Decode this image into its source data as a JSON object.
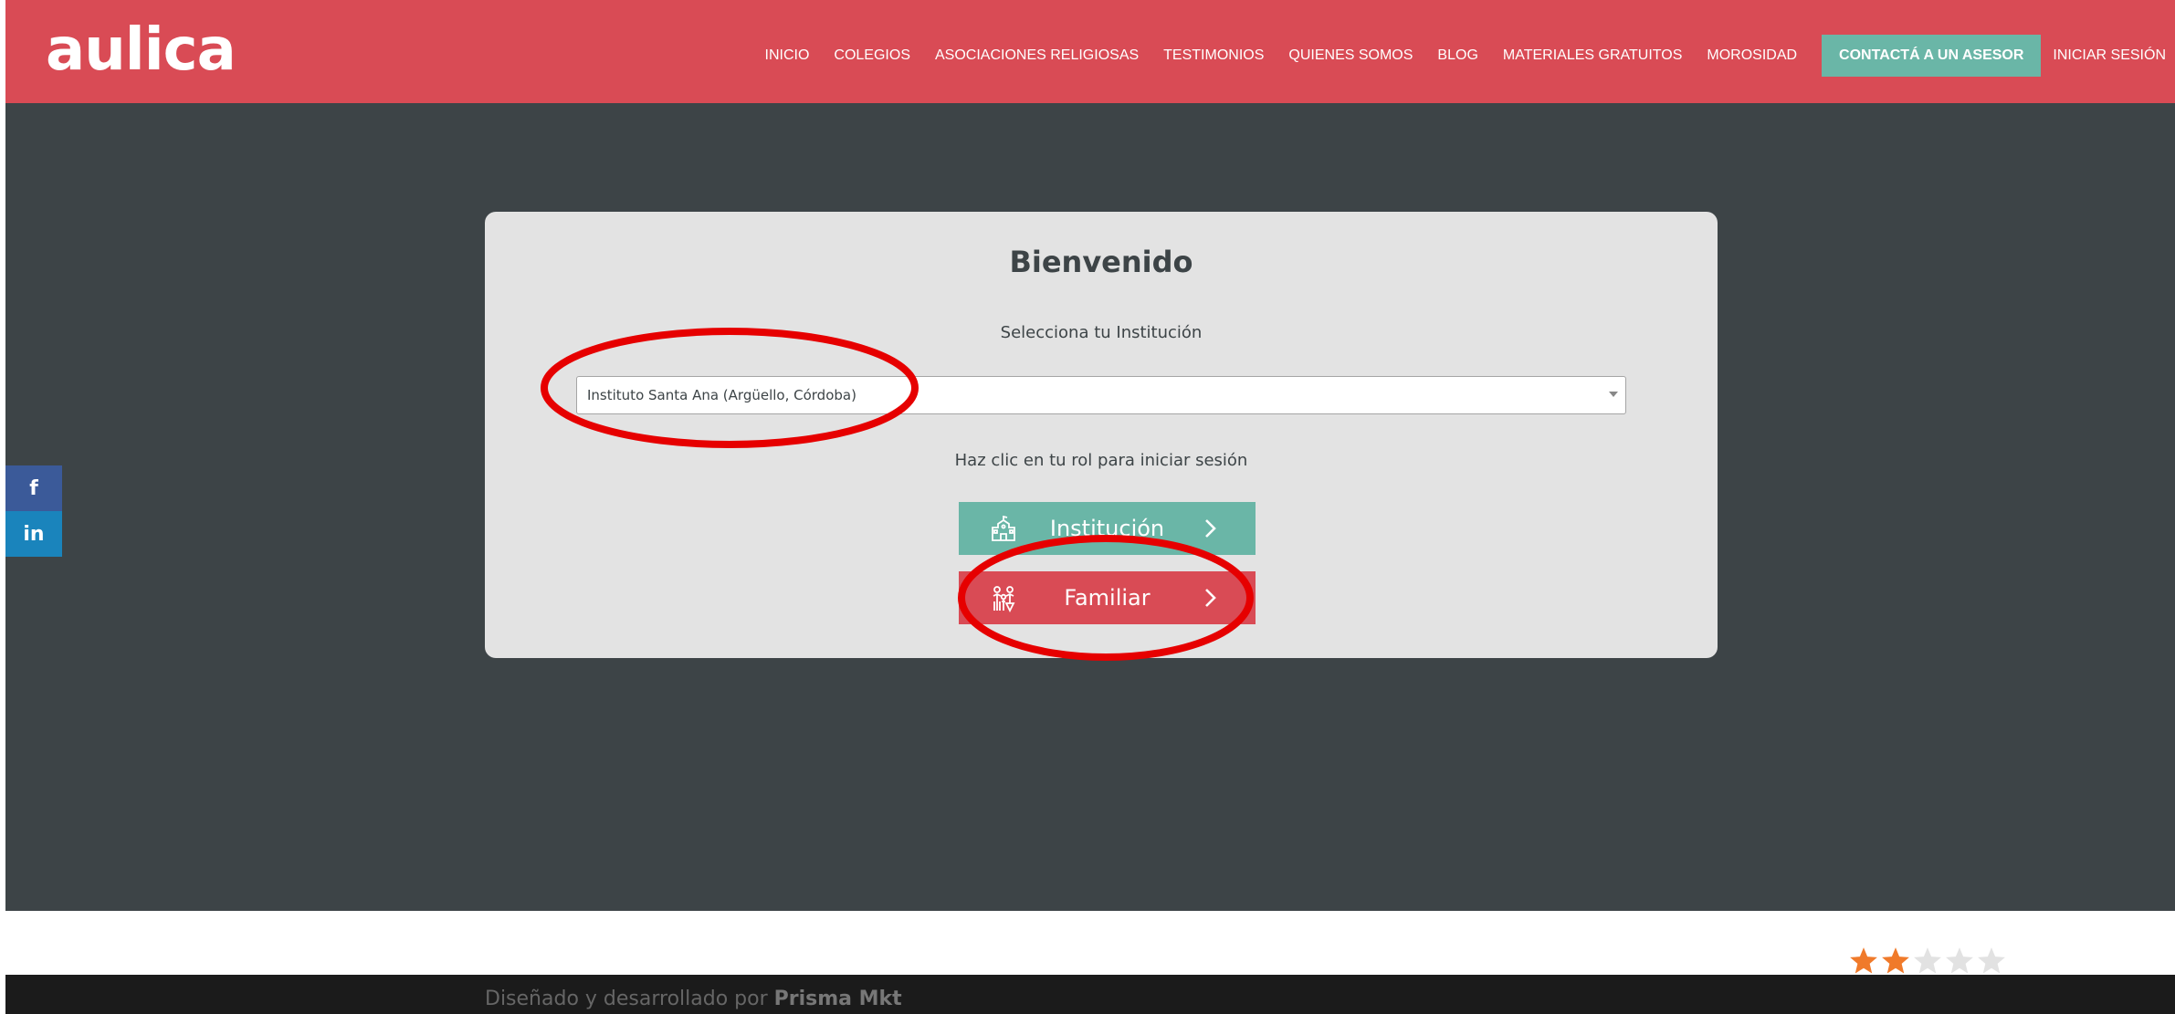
{
  "header": {
    "logo_text": "aulica",
    "nav": [
      "INICIO",
      "COLEGIOS",
      "ASOCIACIONES RELIGIOSAS",
      "TESTIMONIOS",
      "QUIENES SOMOS",
      "BLOG",
      "MATERIALES GRATUITOS",
      "MOROSIDAD"
    ],
    "cta_label": "CONTACTÁ A UN ASESOR",
    "login_label": "INICIAR SESIÓN"
  },
  "social": {
    "facebook": "f",
    "linkedin": "in"
  },
  "card": {
    "title": "Bienvenido",
    "select_label": "Selecciona tu Institución",
    "selected_institution": "Instituto Santa Ana (Argüello, Córdoba)",
    "role_prompt": "Haz clic en tu rol para iniciar sesión",
    "role_institution": "Institución",
    "role_family": "Familiar"
  },
  "rating": {
    "value": 2,
    "max": 5
  },
  "footer": {
    "prefix": "Diseñado y desarrollado por ",
    "brand": "Prisma Mkt"
  },
  "colors": {
    "brand_red": "#d94b55",
    "teal": "#6ab6a7",
    "dark_bg": "#3d4447",
    "card_bg": "#e3e3e3",
    "annotation_red": "#e60000",
    "star_active": "#f07a2a"
  }
}
